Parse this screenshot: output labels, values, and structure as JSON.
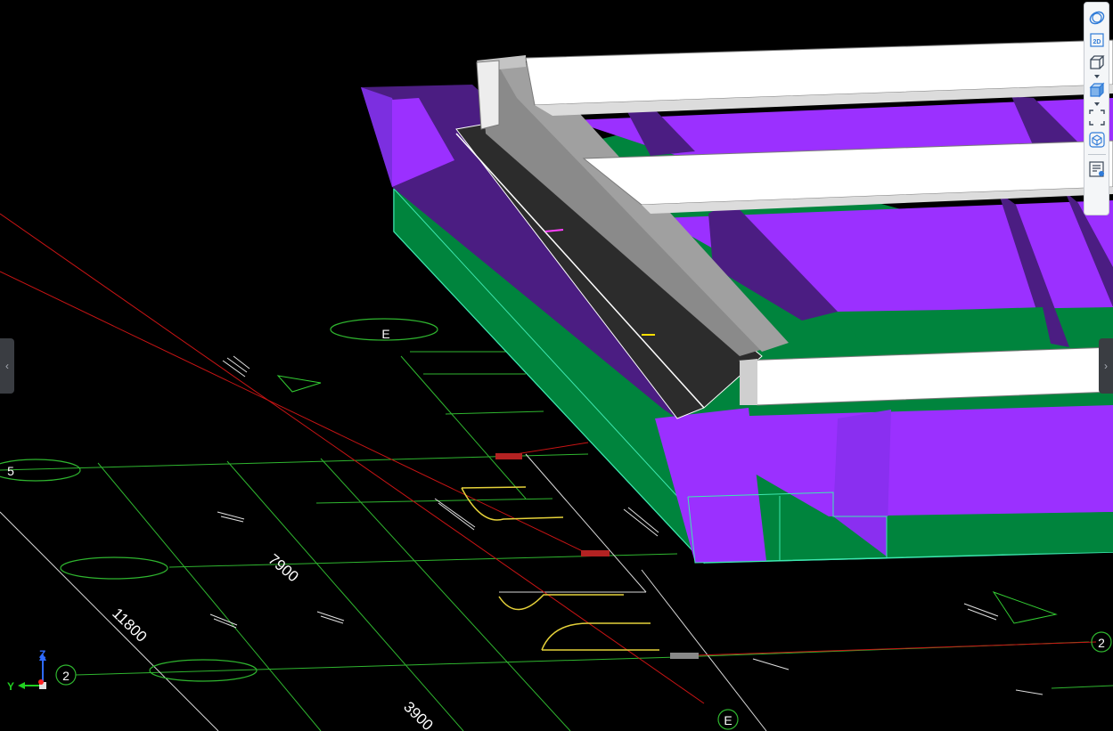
{
  "grid_bubbles": {
    "E_top": "E",
    "E_bottom": "E",
    "row_5": "5",
    "row_2_left": "2",
    "row_2_right": "2"
  },
  "dimensions": {
    "d_7900": "7900",
    "d_11800": "11800",
    "d_3900": "3900"
  },
  "axis_triad": {
    "z": "Z",
    "y": "Y"
  },
  "toolbar": {
    "orbit": "orbit-icon",
    "view_2d": "2D",
    "wireframe_box": "box-icon",
    "shaded_box": "shaded-box-icon",
    "fit_view": "fit-view-icon",
    "model_cube": "cube-icon",
    "properties": "properties-icon"
  },
  "colors": {
    "purple": "#9b30ff",
    "purple_dark": "#4b1d82",
    "green": "#00843d",
    "grid_green": "#33cc33",
    "red_line": "#cc1111",
    "white_beam": "#ffffff",
    "grey_beam": "#8a8a8a",
    "toolbar_accent": "#2f7bd8"
  }
}
